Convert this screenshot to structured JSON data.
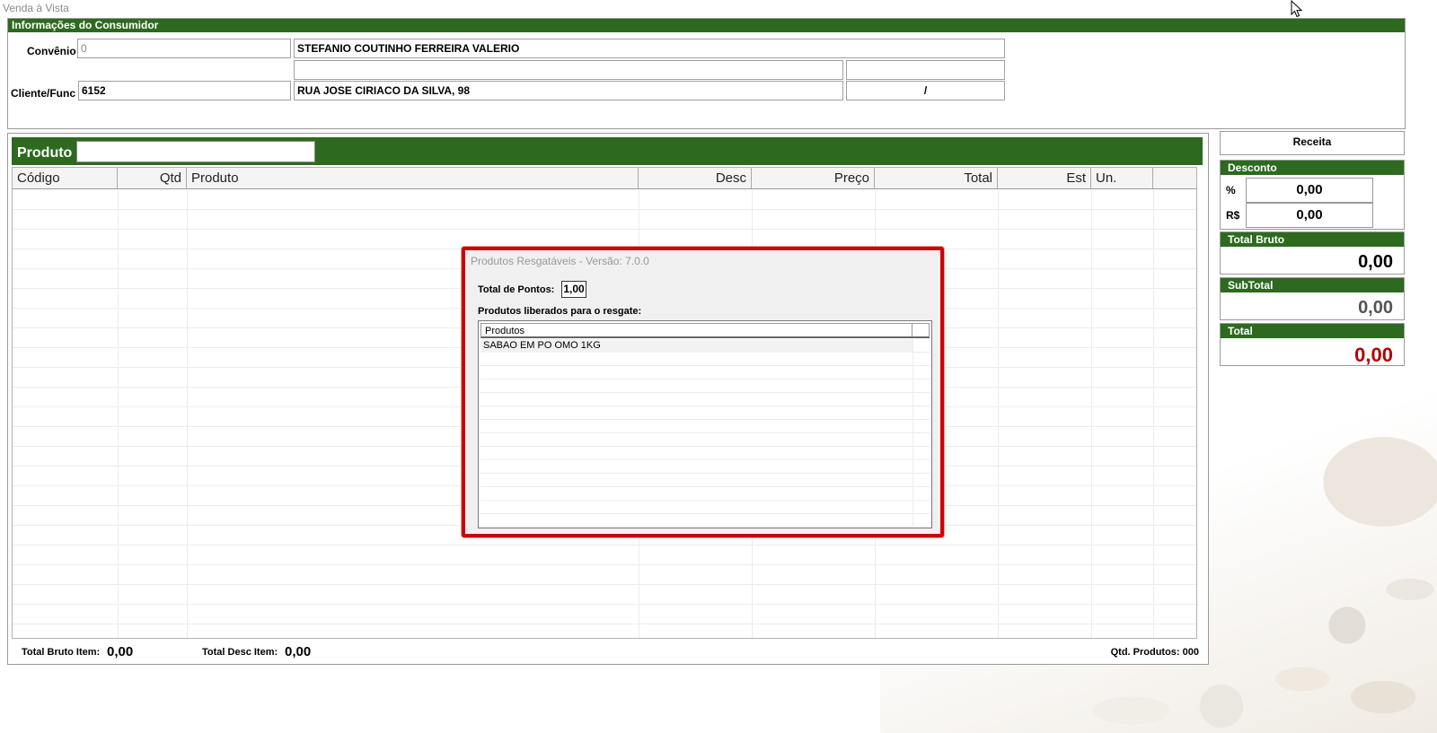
{
  "window": {
    "title": "Venda à Vista"
  },
  "consumer": {
    "header": "Informações do Consumidor",
    "convenio_label": "Convênio",
    "convenio_code": "0",
    "convenio_name": "STEFANIO COUTINHO FERREIRA VALERIO",
    "extra_1": "",
    "extra_2": "",
    "cliente_label": "Cliente/Func",
    "cliente_code": "6152",
    "address": "RUA JOSE CIRIACO DA SILVA, 98",
    "city_uf": "/"
  },
  "product": {
    "label": "Produto",
    "search_value": "",
    "columns": [
      "Código",
      "Qtd",
      "Produto",
      "Desc",
      "Preço",
      "Total",
      "Est",
      "Un."
    ],
    "rows": []
  },
  "footer": {
    "total_bruto_item_label": "Total Bruto Item:",
    "total_bruto_item_value": "0,00",
    "total_desc_item_label": "Total Desc Item:",
    "total_desc_item_value": "0,00",
    "qtd_produtos": "Qtd. Produtos: 000"
  },
  "summary": {
    "receita_label": "Receita",
    "desconto_header": "Desconto",
    "percent_label": "%",
    "percent_value": "0,00",
    "rs_label": "R$",
    "rs_value": "0,00",
    "total_bruto_header": "Total Bruto",
    "total_bruto_value": "0,00",
    "subtotal_header": "SubTotal",
    "subtotal_value": "0,00",
    "total_header": "Total",
    "total_value": "0,00",
    "total_color": "#b30000"
  },
  "dialog": {
    "title": "Produtos Resgatáveis - Versão: 7.0.0",
    "total_pontos_label": "Total de Pontos:",
    "total_pontos_value": "1,00",
    "liberados_label": "Produtos liberados para o resgate:",
    "list_header": "Produtos",
    "items": [
      "SABAO EM PO OMO 1KG"
    ],
    "highlight_color": "#cc0000"
  },
  "colors": {
    "header_green": "#2d6a1f"
  }
}
